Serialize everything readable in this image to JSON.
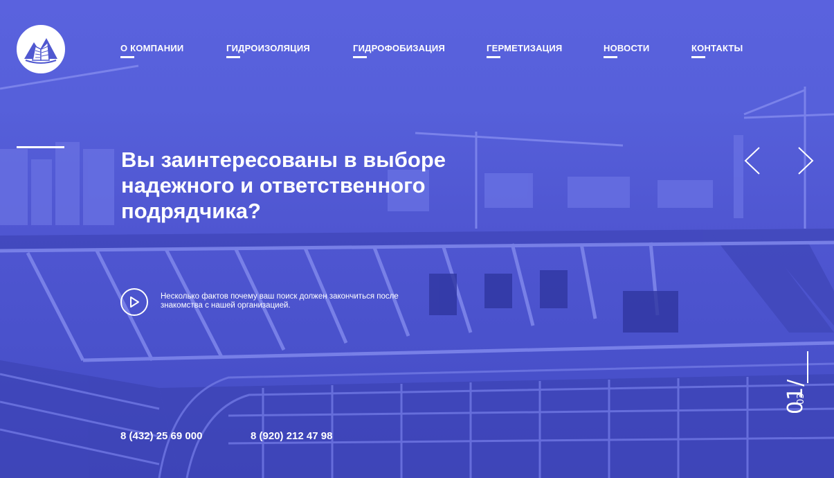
{
  "nav": {
    "items": [
      {
        "label": "О КОМПАНИИ"
      },
      {
        "label": "ГИДРОИЗОЛЯЦИЯ"
      },
      {
        "label": "ГИДРОФОБИЗАЦИЯ"
      },
      {
        "label": "ГЕРМЕТИЗАЦИЯ"
      },
      {
        "label": "НОВОСТИ"
      },
      {
        "label": "КОНТАКТЫ"
      }
    ]
  },
  "hero": {
    "headline": "Вы заинтересованы в выборе надежного и ответственного подрядчика?",
    "video_caption": "Несколько фактов почему ваш поиск должен закончиться после знакомства с нашей организацией."
  },
  "contacts": {
    "phone_1": "8 (432) 25 69 000",
    "phone_2": "8 (920) 212 47 98"
  },
  "slider": {
    "current": "01/",
    "total": "03"
  },
  "colors": {
    "overlay": "#5560d8",
    "text": "#ffffff"
  },
  "icons": {
    "logo": "mountain-building-logo",
    "prev": "chevron-left-icon",
    "next": "chevron-right-icon",
    "play": "play-icon"
  }
}
